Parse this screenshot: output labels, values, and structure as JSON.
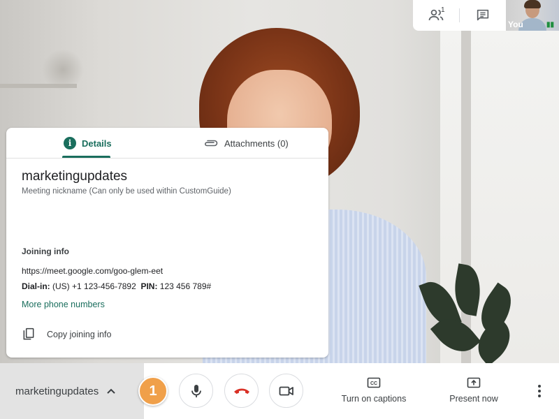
{
  "top_bar": {
    "participants_count": "1",
    "self_label": "You"
  },
  "details_panel": {
    "tabs": [
      {
        "label": "Details",
        "active": true
      },
      {
        "label": "Attachments (0)",
        "active": false
      }
    ],
    "meeting_name": "marketingupdates",
    "meeting_subtitle": "Meeting nickname (Can only be used within CustomGuide)",
    "joining_heading": "Joining info",
    "join_url_prefix": "https://meet.google.com/",
    "join_url_code": "goo-glem-eet",
    "dial_label": "Dial-in:",
    "dial_number": "(US) +1 123-456-7892",
    "pin_label": "PIN:",
    "pin_value": "123 456 789#",
    "more_phone_numbers": "More phone numbers",
    "copy_joining_info": "Copy joining info"
  },
  "bottom_bar": {
    "meeting_toggle_label": "marketingupdates",
    "step_badge": "1",
    "captions_label": "Turn on captions",
    "present_label": "Present now"
  },
  "colors": {
    "accent": "#1a6e5d",
    "hangup": "#d93025",
    "badge": "#f0a04a"
  },
  "icons": [
    "people-icon",
    "chat-icon",
    "info-icon",
    "paperclip-icon",
    "copy-icon",
    "chevron-up-icon",
    "microphone-icon",
    "hang-up-icon",
    "camera-icon",
    "captions-icon",
    "present-screen-icon",
    "more-vert-icon"
  ]
}
